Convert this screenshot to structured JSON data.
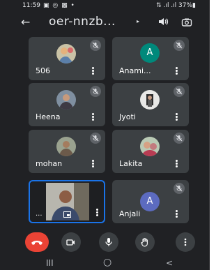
{
  "status": {
    "time": "11:59",
    "icons": "▣ ◎ ▩ •",
    "right": "⇅ .ıl .ıl 37%▮"
  },
  "topbar": {
    "title": "oer-nnzb...",
    "caret": "▸"
  },
  "participants": [
    {
      "name": "506",
      "type": "photo"
    },
    {
      "name": "Anami...",
      "type": "letter",
      "letter": "A",
      "color": "#00897b"
    },
    {
      "name": "Heena",
      "type": "photo"
    },
    {
      "name": "Jyoti",
      "type": "photo"
    },
    {
      "name": "mohan",
      "type": "photo"
    },
    {
      "name": "Lakita",
      "type": "photo"
    },
    {
      "name": "Anjali",
      "type": "letter",
      "letter": "A",
      "color": "#5c6bc0"
    }
  ],
  "self": {
    "name": "..."
  },
  "colors": {
    "end_call": "#ea4335",
    "self_border": "#1a73e8"
  },
  "nav": {
    "recents": "III",
    "home": "○",
    "back": "<"
  }
}
